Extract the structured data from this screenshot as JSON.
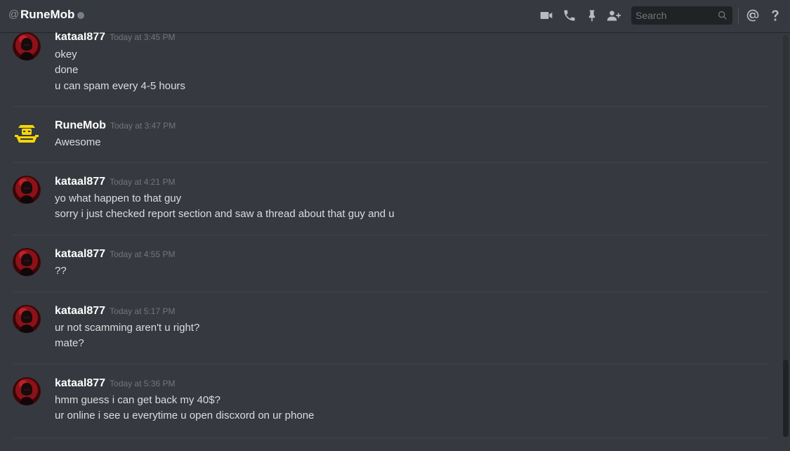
{
  "header": {
    "at_symbol": "@",
    "channel_name": "RuneMob",
    "status": "offline",
    "search_placeholder": "Search",
    "icons": [
      "video-icon",
      "phone-icon",
      "pin-icon",
      "add-member-icon",
      "search-icon",
      "mention-icon",
      "help-icon"
    ]
  },
  "messages": [
    {
      "author": "kataal877",
      "timestamp": "Today at 3:45 PM",
      "lines": [
        "okey",
        "done",
        "u can spam every 4-5 hours"
      ]
    },
    {
      "author": "RuneMob",
      "timestamp": "Today at 3:47 PM",
      "lines": [
        "Awesome"
      ]
    },
    {
      "author": "kataal877",
      "timestamp": "Today at 4:21 PM",
      "lines": [
        "yo what happen to that guy",
        "sorry i just checked report section and saw a thread about that guy and u"
      ]
    },
    {
      "author": "kataal877",
      "timestamp": "Today at 4:55 PM",
      "lines": [
        "??"
      ]
    },
    {
      "author": "kataal877",
      "timestamp": "Today at 5:17 PM",
      "lines": [
        "ur not scamming aren't u right?",
        "mate?"
      ]
    },
    {
      "author": "kataal877",
      "timestamp": "Today at 5:36 PM",
      "lines": [
        "hmm guess i can get back my 40$?",
        "ur online i see u everytime u open discxord on ur phone"
      ]
    }
  ],
  "colors": {
    "background": "#36393f",
    "text": "#dcddde",
    "timestamp": "#72767d",
    "runemob_logo": "#f5d50a",
    "status_offline": "#747f8d"
  }
}
